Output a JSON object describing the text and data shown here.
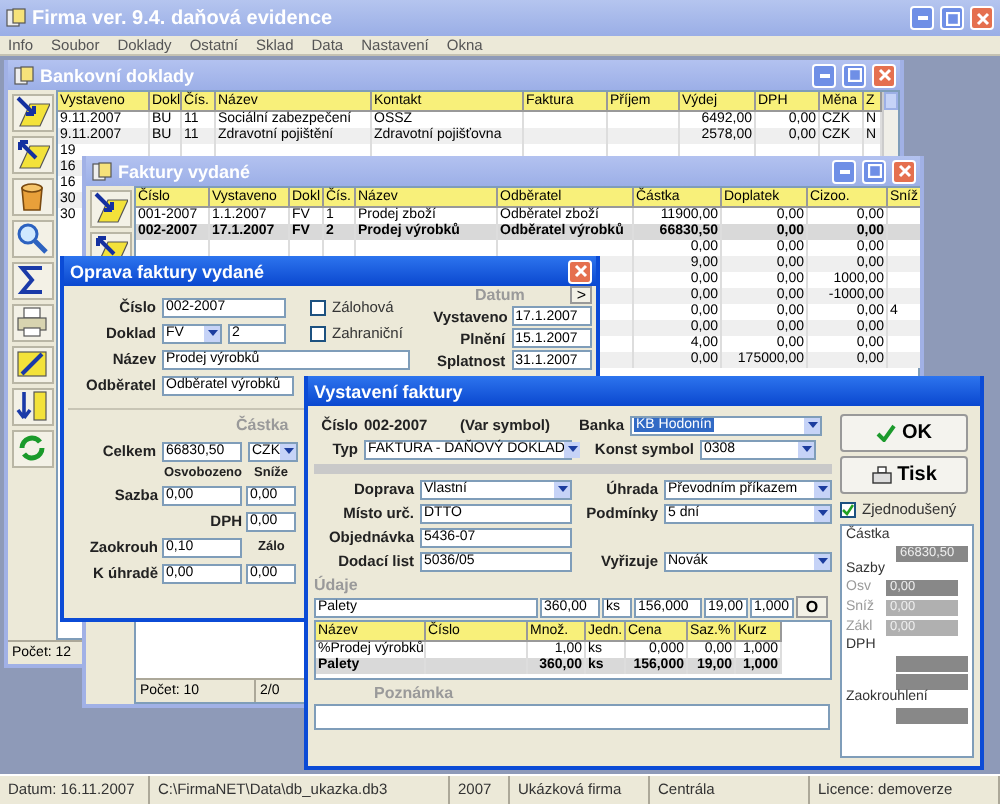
{
  "app": {
    "title": "Firma ver. 9.4. daňová evidence",
    "menu": [
      "Info",
      "Soubor",
      "Doklady",
      "Ostatní",
      "Sklad",
      "Data",
      "Nastavení",
      "Okna"
    ]
  },
  "bank_window": {
    "title": "Bankovní doklady",
    "active": false,
    "columns": [
      "Vystaveno",
      "Dokl",
      "Čís.",
      "Název",
      "Kontakt",
      "Faktura",
      "Příjem",
      "Výdej",
      "DPH",
      "Měna",
      "Z"
    ],
    "rows": [
      {
        "cells": [
          "9.11.2007",
          "BU",
          "11",
          "Sociální zabezpečení",
          "OSSZ",
          null,
          null,
          "6492,00",
          "0,00",
          "CZK",
          "N"
        ]
      },
      {
        "cells": [
          "9.11.2007",
          "BU",
          "11",
          "Zdravotní pojištění",
          "Zdravotní pojišťovna",
          null,
          null,
          "2578,00",
          "0,00",
          "CZK",
          "N"
        ]
      },
      {
        "cells": [
          "19"
        ]
      },
      {
        "cells": [
          "16"
        ]
      },
      {
        "cells": [
          "16"
        ]
      },
      {
        "cells": [
          "30"
        ]
      },
      {
        "cells": [
          "30"
        ]
      }
    ],
    "footer": "Počet: 12"
  },
  "invoices_window": {
    "title": "Faktury vydané",
    "active": false,
    "columns": [
      "Číslo",
      "Vystaveno",
      "Dokl",
      "Čís.",
      "Název",
      "Odběratel",
      "Částka",
      "Doplatek",
      "Cizoo.",
      "Sníž"
    ],
    "rows": [
      {
        "cells": [
          "001-2007",
          "1.1.2007",
          "FV",
          "1",
          "Prodej zboží",
          "Odběratel zboží",
          "11900,00",
          "0,00",
          "0,00"
        ],
        "selected": false
      },
      {
        "cells": [
          "002-2007",
          "17.1.2007",
          "FV",
          "2",
          "Prodej výrobků",
          "Odběratel výrobků",
          "66830,50",
          "0,00",
          "0,00"
        ],
        "selected": true
      }
    ],
    "partial_rows": [
      [
        "0,00",
        "0,00",
        "0,00"
      ],
      [
        "9,00",
        "0,00",
        "0,00"
      ],
      [
        "0,00",
        "0,00",
        "1000,00"
      ],
      [
        "0,00",
        "0,00",
        "-1000,00"
      ],
      [
        "0,00",
        "0,00",
        "0,00",
        "4"
      ],
      [
        "0,00",
        "0,00",
        "0,00"
      ],
      [
        "4,00",
        "0,00",
        "0,00"
      ],
      [
        "0,00",
        "175000,00",
        "0,00"
      ]
    ],
    "footer": [
      "Počet: 10",
      "2/0"
    ]
  },
  "edit_window": {
    "title": "Oprava faktury vydané",
    "active": true,
    "cislo": {
      "label": "Číslo",
      "value": "002-2007"
    },
    "doklad": {
      "label": "Doklad",
      "type": "FV",
      "number": "2"
    },
    "nazev": {
      "label": "Název",
      "value": "Prodej výrobků"
    },
    "odberatel": {
      "label": "Odběratel",
      "value": "Odběratel výrobků"
    },
    "checks": [
      {
        "label": "Zálohová",
        "checked": false
      },
      {
        "label": "Zahraniční",
        "checked": false
      }
    ],
    "datum": {
      "title": "Datum",
      "button": ">",
      "rows": [
        {
          "label": "Vystaveno",
          "value": "17.1.2007"
        },
        {
          "label": "Plnění",
          "value": "15.1.2007"
        },
        {
          "label": "Splatnost",
          "value": "31.1.2007"
        }
      ]
    },
    "castka": {
      "title": "Částka",
      "celkem_label": "Celkem",
      "celkem": "66830,50",
      "currency": "CZK",
      "headers": [
        "Osvobozeno",
        "Sníže"
      ],
      "sazba_label": "Sazba",
      "sazba": [
        "0,00",
        "0,00"
      ],
      "dph_label": "DPH",
      "dph": "0,00",
      "zaokrouh_label": "Zaokrouh",
      "zaokrouh": "0,10",
      "zalo": "Zálo",
      "kuhrade_label": "K úhradě",
      "kuhrade": [
        "0,00",
        "0,00"
      ]
    }
  },
  "issue_window": {
    "title": "Vystavení faktury",
    "active": true,
    "cislo_label": "Číslo",
    "cislo": "002-2007",
    "var_symbol": "(Var symbol)",
    "fields_left": [
      {
        "label": "Typ",
        "value": "FAKTURA - DAŇOVÝ DOKLAD",
        "kind": "dropdown"
      }
    ],
    "banka": {
      "label": "Banka",
      "value": "KB Hodonín",
      "selected": true
    },
    "konst": {
      "label": "Konst symbol",
      "value": "0308"
    },
    "doprava": [
      {
        "label": "Doprava",
        "value": "Vlastní",
        "kind": "dropdown"
      },
      {
        "label": "Místo urč.",
        "value": "DTTO",
        "kind": "text"
      },
      {
        "label": "Objednávka",
        "value": "5436-07",
        "kind": "text"
      },
      {
        "label": "Dodací list",
        "value": "5036/05",
        "kind": "text"
      }
    ],
    "uhrada": [
      {
        "label": "Úhrada",
        "value": "Převodním příkazem"
      },
      {
        "label": "Podmínky",
        "value": "5 dní"
      },
      {
        "label": "Vyřizuje",
        "value": "Novák"
      }
    ],
    "udaje_title": "Údaje",
    "item_entry": [
      "Palety",
      "360,00",
      "ks",
      "156,000",
      "19,00",
      "1,000"
    ],
    "item_button": "O",
    "items_columns": [
      "Název",
      "Číslo",
      "Množ.",
      "Jedn.",
      "Cena",
      "Saz.%",
      "Kurz"
    ],
    "items": [
      {
        "cells": [
          "%Prodej výrobků",
          null,
          "1,00",
          "ks",
          "0,000",
          "0,00",
          "1,000"
        ],
        "selected": false
      },
      {
        "cells": [
          "Palety",
          null,
          "360,00",
          "ks",
          "156,000",
          "19,00",
          "1,000"
        ],
        "selected": true
      }
    ],
    "note_title": "Poznámka",
    "ok": "OK",
    "print": "Tisk",
    "simplified": {
      "label": "Zjednodušený",
      "checked": true
    },
    "summary": {
      "title": "Částka",
      "total": "66830,50",
      "rates_title": "Sazby",
      "rates": [
        {
          "label": "Osv",
          "value": "0,00"
        },
        {
          "label": "Sníž",
          "value": "0,00"
        },
        {
          "label": "Zákl",
          "value": "0,00"
        }
      ],
      "dph_title": "DPH",
      "rounding_title": "Zaokrouhlení"
    }
  },
  "status_bar": [
    "Datum: 16.11.2007",
    "C:\\FirmaNET\\Data\\db_ukazka.db3",
    "2007",
    "Ukázková firma",
    "Centrála",
    "Licence: demoverze"
  ]
}
